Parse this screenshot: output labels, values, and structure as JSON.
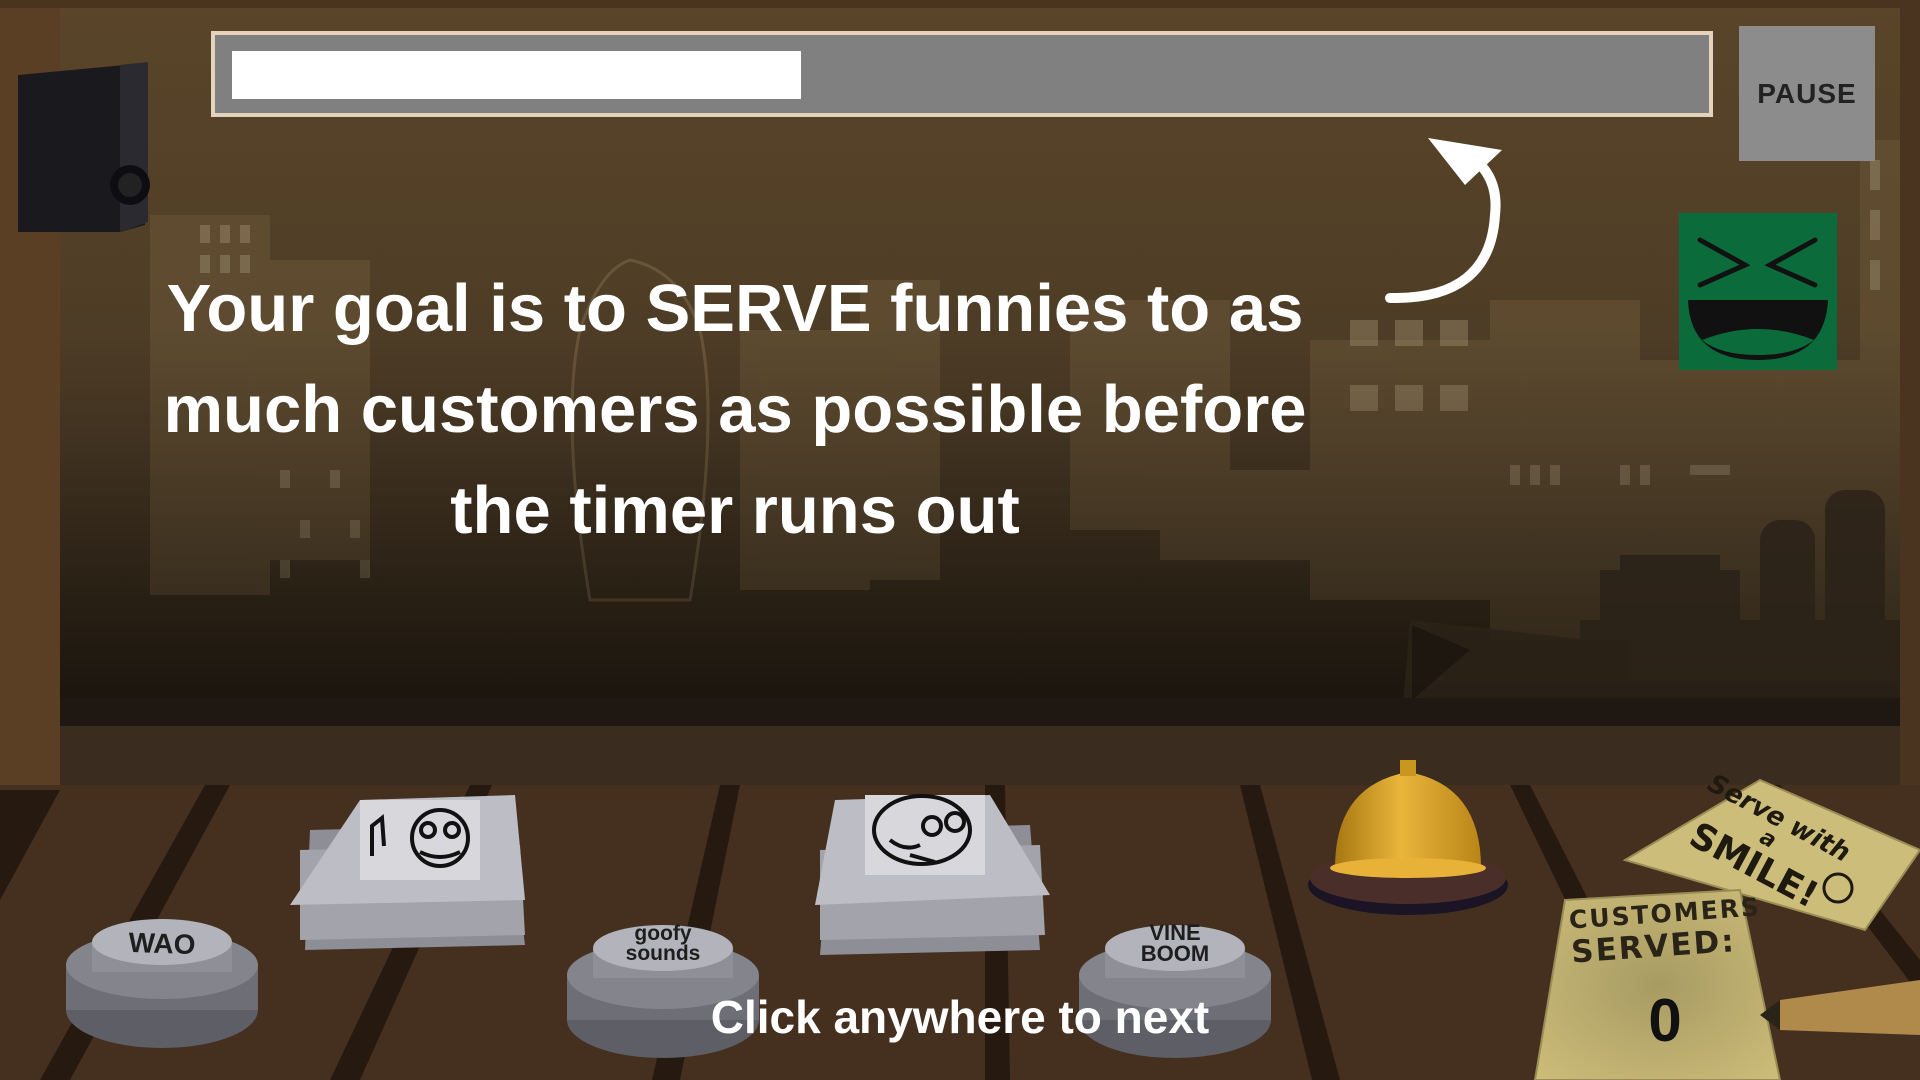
{
  "timer": {
    "remaining_fraction": 0.39
  },
  "pause_button": {
    "label": "PAUSE"
  },
  "instruction": {
    "line1": "Your goal is to SERVE funnies to as",
    "line2": "much customers as possible before",
    "line3": "the timer runs out"
  },
  "next_hint": "Click anywhere to next",
  "sound_buttons": [
    {
      "label": "WAO"
    },
    {
      "label_line1": "goofy",
      "label_line2": "sounds"
    },
    {
      "label_line1": "VINE",
      "label_line2": "BOOM"
    }
  ],
  "customer_counter": {
    "title_line1": "CUSTOMERS",
    "title_line2": "SERVED:",
    "value": "0"
  },
  "sign": {
    "line1": "Serve with",
    "line2": "a",
    "line3": "SMILE!"
  },
  "icons": [
    "speaker-icon",
    "laughing-face-icon",
    "arrow-up-icon",
    "service-bell-icon",
    "meme-card-stack-icon"
  ],
  "colors": {
    "customer_face": "#0b6b3a",
    "bell": "#d9a62a",
    "paper": "#cdbd7a"
  }
}
